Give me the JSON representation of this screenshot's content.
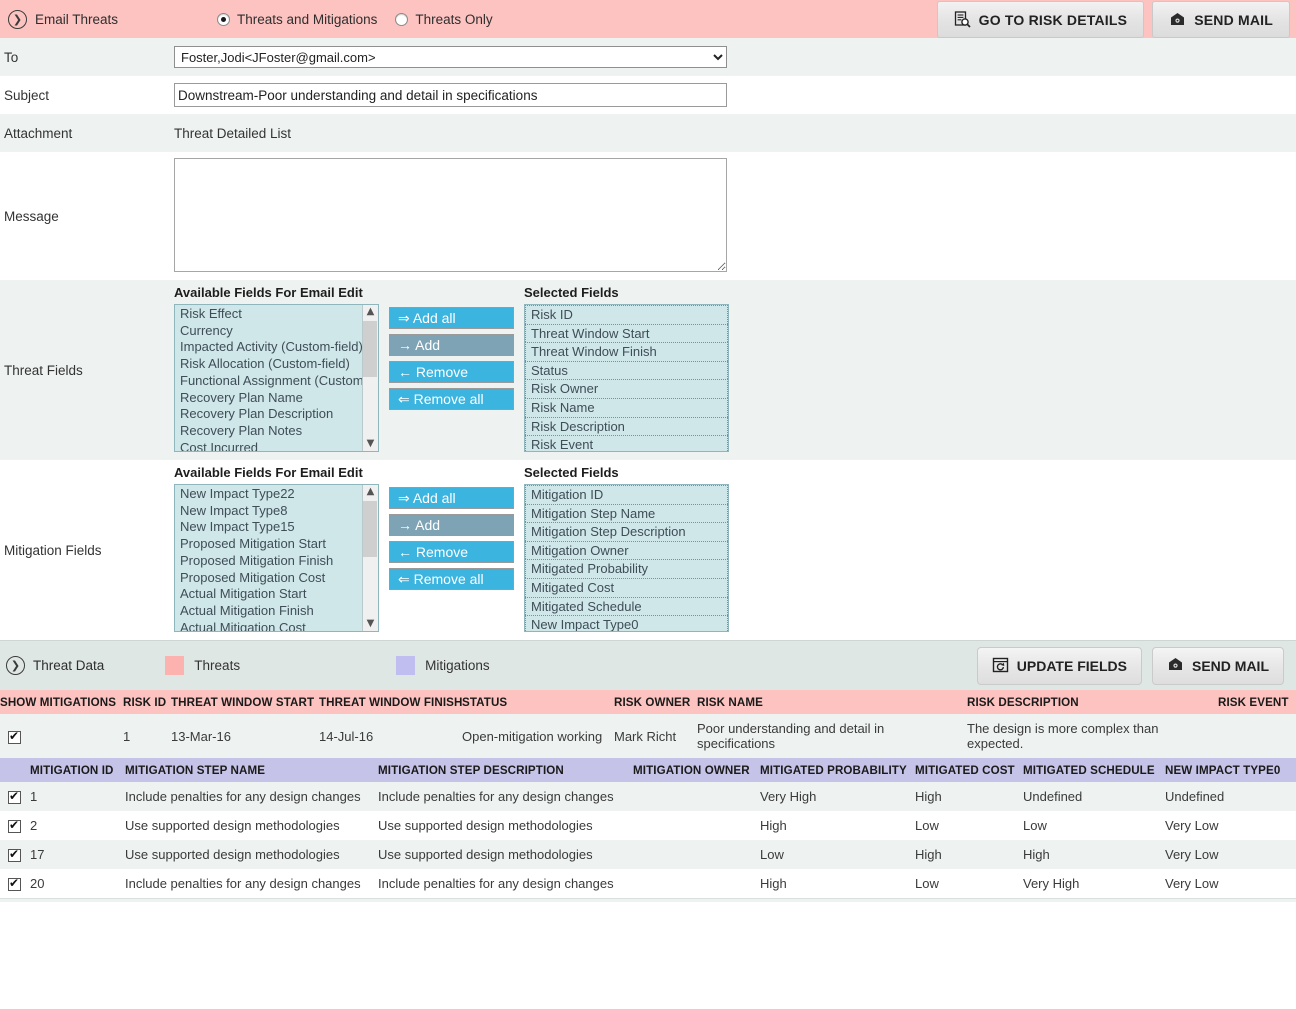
{
  "header": {
    "panel_title": "Email Threats",
    "expand_icon": "chevron-right-circle-icon",
    "radios": [
      {
        "label": "Threats and Mitigations",
        "checked": true
      },
      {
        "label": "Threats Only",
        "checked": false
      }
    ],
    "buttons": [
      {
        "label": "GO TO RISK DETAILS",
        "icon": "document-search-icon"
      },
      {
        "label": "SEND MAIL",
        "icon": "mail-icon"
      }
    ]
  },
  "form": {
    "to_label": "To",
    "to_value": "Foster,Jodi<JFoster@gmail.com>",
    "subject_label": "Subject",
    "subject_value": "Downstream-Poor understanding and detail in specifications",
    "attachment_label": "Attachment",
    "attachment_value": "Threat Detailed List",
    "message_label": "Message",
    "message_value": "",
    "message_placeholder": ""
  },
  "threat_fields": {
    "row_label": "Threat Fields",
    "available_heading": "Available Fields For Email Edit",
    "selected_heading": "Selected Fields",
    "available": [
      "Risk Effect",
      "Currency",
      "Impacted Activity (Custom-field)",
      "Risk Allocation (Custom-field)",
      "Functional Assignment (Custom-f",
      "Recovery Plan Name",
      "Recovery Plan Description",
      "Recovery Plan Notes",
      "Cost Incurred"
    ],
    "selected": [
      "Risk ID",
      "Threat Window Start",
      "Threat Window Finish",
      "Status",
      "Risk Owner",
      "Risk Name",
      "Risk Description",
      "Risk Event"
    ],
    "buttons": [
      {
        "label": "⇒ Add all",
        "state": "normal"
      },
      {
        "label": "→ Add",
        "state": "hover"
      },
      {
        "label": "← Remove",
        "state": "normal"
      },
      {
        "label": "⇐ Remove all",
        "state": "normal"
      }
    ]
  },
  "mitigation_fields": {
    "row_label": "Mitigation Fields",
    "available_heading": "Available Fields For Email Edit",
    "selected_heading": "Selected Fields",
    "available": [
      "New Impact Type22",
      "New Impact Type8",
      "New Impact Type15",
      "Proposed Mitigation Start",
      "Proposed Mitigation Finish",
      "Proposed Mitigation Cost",
      "Actual Mitigation Start",
      "Actual Mitigation Finish",
      "Actual Mitigation Cost"
    ],
    "selected": [
      "Mitigation ID",
      "Mitigation Step Name",
      "Mitigation Step Description",
      "Mitigation Owner",
      "Mitigated Probability",
      "Mitigated Cost",
      "Mitigated Schedule",
      "New Impact Type0"
    ],
    "buttons": [
      {
        "label": "⇒ Add all",
        "state": "normal"
      },
      {
        "label": "→ Add",
        "state": "hover"
      },
      {
        "label": "← Remove",
        "state": "normal"
      },
      {
        "label": "⇐ Remove all",
        "state": "normal"
      }
    ]
  },
  "threat_data_bar": {
    "panel_title": "Threat Data",
    "expand_icon": "chevron-right-circle-icon",
    "legend": [
      {
        "label": "Threats",
        "color": "#fcb2ae"
      },
      {
        "label": "Mitigations",
        "color": "#c0bef0"
      }
    ],
    "buttons": [
      {
        "label": "UPDATE FIELDS",
        "icon": "refresh-window-icon"
      },
      {
        "label": "SEND MAIL",
        "icon": "mail-icon"
      }
    ]
  },
  "threat_table": {
    "columns": [
      "SHOW MITIGATIONS",
      "RISK ID",
      "THREAT WINDOW START",
      "THREAT WINDOW FINISH",
      "STATUS",
      "RISK OWNER",
      "RISK NAME",
      "RISK DESCRIPTION",
      "RISK EVENT"
    ],
    "rows": [
      {
        "show_mitigations": true,
        "risk_id": "1",
        "threat_window_start": "13-Mar-16",
        "threat_window_finish": "14-Jul-16",
        "status": "Open-mitigation working",
        "risk_owner": "Mark Richt",
        "risk_name": "Poor understanding and detail in specifications",
        "risk_description": "The design is more complex than expected.",
        "risk_event": ""
      }
    ]
  },
  "mitigation_table": {
    "columns": [
      "MITIGATION ID",
      "MITIGATION STEP NAME",
      "MITIGATION STEP DESCRIPTION",
      "MITIGATION OWNER",
      "MITIGATED PROBABILITY",
      "MITIGATED COST",
      "MITIGATED SCHEDULE",
      "NEW IMPACT TYPE0"
    ],
    "rows": [
      {
        "checked": true,
        "mitigation_id": "1",
        "step_name": "Include penalties for any design changes",
        "step_description": "Include penalties for any design changes",
        "owner": "",
        "probability": "Very High",
        "cost": "High",
        "schedule": "Undefined",
        "new_impact_type0": "Undefined"
      },
      {
        "checked": true,
        "mitigation_id": "2",
        "step_name": "Use supported design methodologies",
        "step_description": "Use supported design methodologies",
        "owner": "",
        "probability": "High",
        "cost": "Low",
        "schedule": "Low",
        "new_impact_type0": "Very Low"
      },
      {
        "checked": true,
        "mitigation_id": "17",
        "step_name": "Use supported design methodologies",
        "step_description": "Use supported design methodologies",
        "owner": "",
        "probability": "Low",
        "cost": "High",
        "schedule": "High",
        "new_impact_type0": "Very Low"
      },
      {
        "checked": true,
        "mitigation_id": "20",
        "step_name": "Include penalties for any design changes",
        "step_description": "Include penalties for any design changes",
        "owner": "",
        "probability": "High",
        "cost": "Low",
        "schedule": "Very High",
        "new_impact_type0": "Very Low"
      }
    ]
  },
  "colors": {
    "threat_header": "#fcc3c0",
    "mitigation_header": "#c5c3e8",
    "listbox_bg": "#cfe7e9",
    "picker_button": "#3bb4e0",
    "picker_button_hover": "#7ea3b5",
    "alt_row": "#eef3f2",
    "threat_data_bar": "#dfe7e4"
  }
}
